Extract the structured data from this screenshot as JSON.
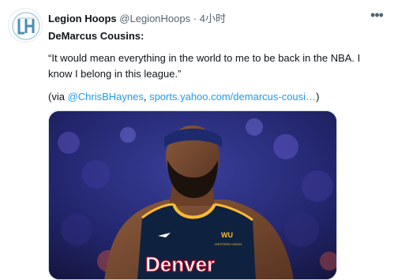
{
  "tweet": {
    "author_name": "Legion Hoops",
    "author_handle": "@LegionHoops",
    "separator": "·",
    "time": "4小时",
    "more_icon": "more-horizontal-icon",
    "subject": "DeMarcus Cousins:",
    "quote": "“It would mean everything in the world to me to be back in the NBA. I know I belong in this league.”",
    "via": {
      "open": "(via ",
      "mention": "@ChrisBHaynes",
      "comma": ", ",
      "url": "sports.yahoo.com/demarcus-cousi…",
      "close": ")"
    },
    "media": {
      "jersey_text": "Denver",
      "patch_top": "WU",
      "patch_bottom": "WESTERN UNION"
    }
  },
  "colors": {
    "text": "#0f1419",
    "secondary": "#536471",
    "link": "#1d9bf0",
    "jersey": "#0e2240",
    "jersey_trim": "#febb30"
  }
}
